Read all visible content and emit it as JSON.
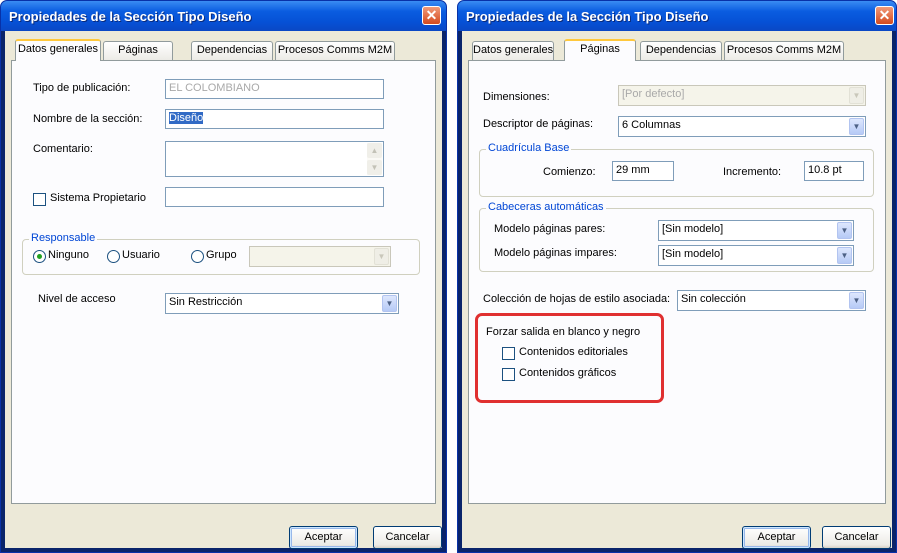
{
  "left_dialog": {
    "title": "Propiedades de la Sección Tipo  Diseño",
    "tabs": [
      "Datos generales",
      "Páginas",
      "Dependencias",
      "Procesos Comms M2M"
    ],
    "tipo_publicacion": {
      "label": "Tipo de publicación:",
      "value": "EL COLOMBIANO"
    },
    "nombre_seccion": {
      "label": "Nombre de la sección:",
      "value": "Diseño"
    },
    "comentario": {
      "label": "Comentario:",
      "value": ""
    },
    "sistema_propietario": {
      "label": "Sistema Propietario",
      "value": ""
    },
    "responsable": {
      "group_label": "Responsable",
      "options": [
        "Ninguno",
        "Usuario",
        "Grupo"
      ],
      "selected": "Ninguno"
    },
    "nivel_acceso": {
      "label": "Nivel de acceso",
      "value": "Sin Restricción"
    },
    "buttons": {
      "ok": "Aceptar",
      "cancel": "Cancelar"
    }
  },
  "right_dialog": {
    "title": "Propiedades de la Sección Tipo  Diseño",
    "tabs": [
      "Datos generales",
      "Páginas",
      "Dependencias",
      "Procesos Comms M2M"
    ],
    "dimensiones": {
      "label": "Dimensiones:",
      "value": "[Por defecto]"
    },
    "descriptor": {
      "label": "Descriptor de páginas:",
      "value": "6 Columnas"
    },
    "cuadricula": {
      "group_label": "Cuadrícula Base",
      "comienzo_label": "Comienzo:",
      "comienzo_value": "29 mm",
      "incremento_label": "Incremento:",
      "incremento_value": "10.8 pt"
    },
    "cabeceras": {
      "group_label": "Cabeceras automáticas",
      "pares_label": "Modelo páginas pares:",
      "pares_value": "[Sin modelo]",
      "impares_label": "Modelo páginas impares:",
      "impares_value": "[Sin modelo]"
    },
    "coleccion": {
      "label": "Colección de hojas de estilo asociada:",
      "value": "Sin colección"
    },
    "forzar": {
      "label": "Forzar salida en blanco y negro",
      "editoriales": "Contenidos editoriales",
      "graficos": "Contenidos gráficos"
    },
    "buttons": {
      "ok": "Aceptar",
      "cancel": "Cancelar"
    }
  },
  "colors": {
    "title_bar": "#0a5ce0",
    "highlight": "#e03030",
    "group_label": "#0046d5"
  }
}
